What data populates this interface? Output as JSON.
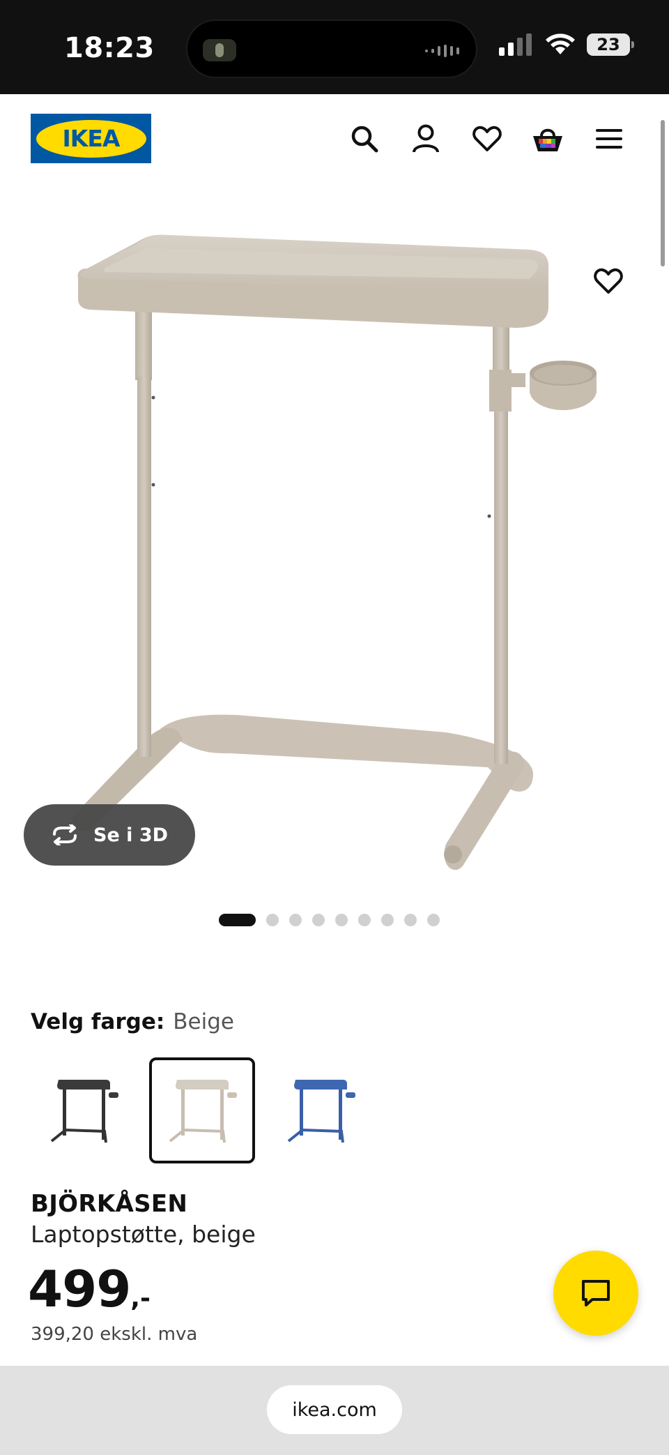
{
  "status_bar": {
    "time": "18:23",
    "battery": "23",
    "icons": [
      "cellular-signal-icon",
      "wifi-icon",
      "battery-icon"
    ]
  },
  "header": {
    "logo_text": "IKEA",
    "icons": [
      "search-icon",
      "account-icon",
      "heart-icon",
      "shopping-bag-icon",
      "menu-icon"
    ],
    "colors": {
      "logo_blue": "#0058a3",
      "logo_yellow": "#ffdb00"
    }
  },
  "gallery": {
    "view_3d_label": "Se i 3D",
    "total_images": 10,
    "active_index": 0
  },
  "color_picker": {
    "label": "Velg farge:",
    "selected": "Beige",
    "options": [
      {
        "name": "Svart",
        "color": "#3a3a3a"
      },
      {
        "name": "Beige",
        "color": "#cdc5b8"
      },
      {
        "name": "Blå",
        "color": "#3f66b0"
      }
    ]
  },
  "product": {
    "name": "BJÖRKÅSEN",
    "description": "Laptopstøtte, beige",
    "price_main": "499",
    "price_suffix": ",-",
    "price_ex_vat": "399,20 ekskl. mva"
  },
  "browser": {
    "url": "ikea.com"
  }
}
